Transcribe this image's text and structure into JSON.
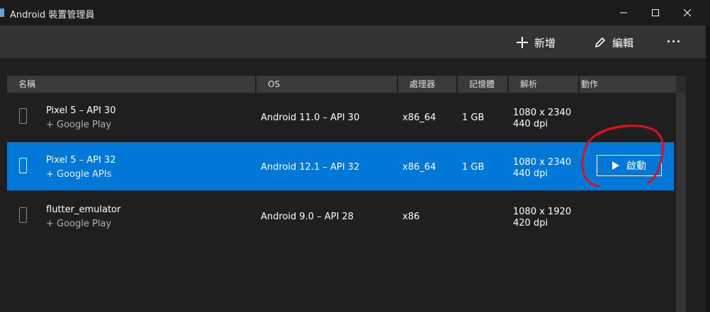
{
  "window": {
    "title": "Android 裝置管理員",
    "minimize_icon": "minimize-icon",
    "maximize_icon": "maximize-icon",
    "close_icon": "close-icon"
  },
  "toolbar": {
    "new_label": "新增",
    "edit_label": "編輯",
    "new_icon": "plus-icon",
    "edit_icon": "pencil-icon",
    "more_icon": "more-icon"
  },
  "columns": {
    "name": "名稱",
    "os": "OS",
    "cpu": "處理器",
    "memory": "記憶體",
    "resolution": "解析",
    "action": "動作"
  },
  "rows": [
    {
      "name": "Pixel 5 – API 30",
      "subtitle": "+ Google Play",
      "os": "Android 11.0 – API 30",
      "cpu": "x86_64",
      "memory": "1 GB",
      "resolution": "1080 x 2340",
      "dpi": "440 dpi",
      "selected": false
    },
    {
      "name": "Pixel 5 – API 32",
      "subtitle": "+ Google APIs",
      "os": "Android 12.1 – API 32",
      "cpu": "x86_64",
      "memory": "1 GB",
      "resolution": "1080 x 2340",
      "dpi": "440 dpi",
      "selected": true,
      "action_label": "啟動"
    },
    {
      "name": "flutter_emulator",
      "subtitle": "+ Google Play",
      "os": "Android 9.0 – API 28",
      "cpu": "x86",
      "memory": "",
      "resolution": "1080 x 1920",
      "dpi": "420 dpi",
      "selected": false
    }
  ],
  "colors": {
    "selected_row": "#0078d7",
    "annotation": "#e0101a",
    "toolbar": "#333333",
    "background": "#1f1f1f"
  }
}
